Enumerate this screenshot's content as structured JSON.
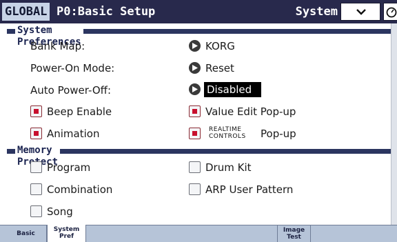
{
  "header": {
    "mode": "GLOBAL",
    "page": "P0:Basic Setup",
    "page_menu": "System Preferences"
  },
  "system_preferences": {
    "section_title": "System Preferences",
    "bank_map": {
      "label": "Bank Map:",
      "value": "KORG"
    },
    "power_on_mode": {
      "label": "Power-On Mode:",
      "value": "Reset"
    },
    "auto_power_off": {
      "label": "Auto Power-Off:",
      "value": "Disabled"
    },
    "beep_enable": {
      "label": "Beep Enable",
      "checked": true
    },
    "value_edit_popup": {
      "label": "Value Edit Pop-up",
      "checked": true
    },
    "animation": {
      "label": "Animation",
      "checked": true
    },
    "realtime_controls_popup": {
      "prefix_line1": "REALTIME",
      "prefix_line2": "CONTROLS",
      "label": "Pop-up",
      "checked": true
    }
  },
  "memory_protect": {
    "section_title": "Memory Protect",
    "program": {
      "label": "Program",
      "checked": false
    },
    "drum_kit": {
      "label": "Drum Kit",
      "checked": false
    },
    "combination": {
      "label": "Combination",
      "checked": false
    },
    "arp_user_pattern": {
      "label": "ARP User Pattern",
      "checked": false
    },
    "song": {
      "label": "Song",
      "checked": false
    }
  },
  "tabs": [
    {
      "line1": "Basic",
      "line2": "",
      "active": false
    },
    {
      "line1": "System",
      "line2": "Pref",
      "active": true
    },
    {
      "line1": "Image",
      "line2": "Test",
      "active": false
    }
  ],
  "colors": {
    "header_bg": "#28294c",
    "accent": "#c8102e",
    "section_bar": "#2b3560"
  }
}
